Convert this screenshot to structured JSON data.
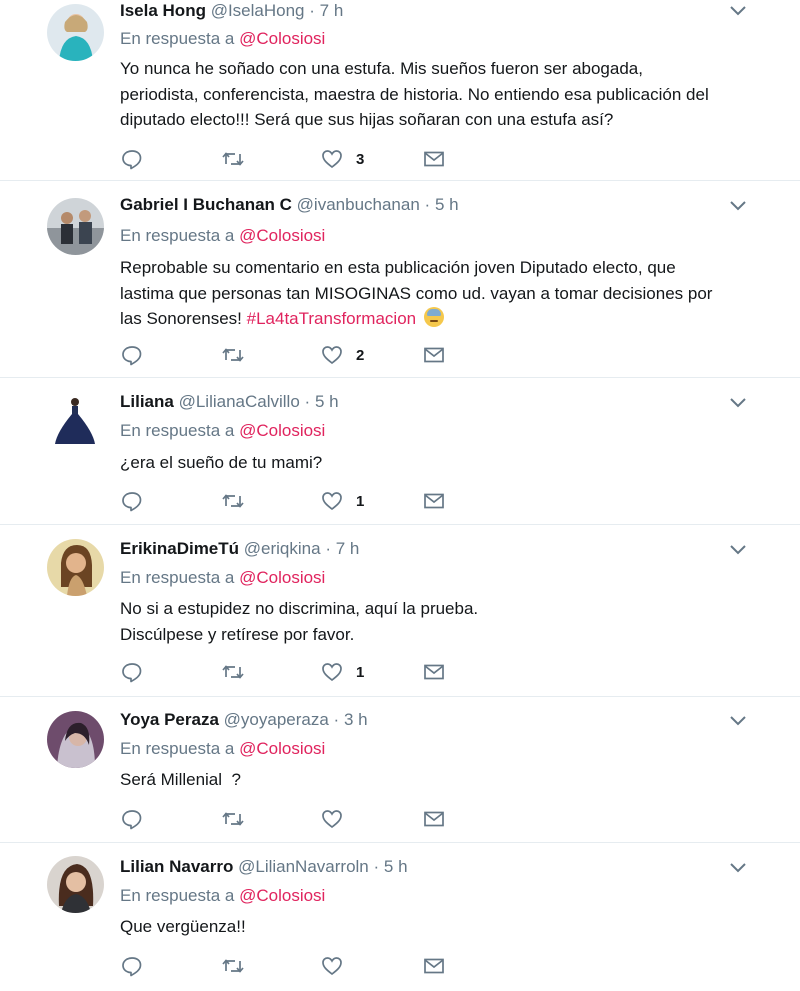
{
  "reply_prefix": "En respuesta a",
  "tweets": [
    {
      "name": "Isela Hong",
      "handle": "@IselaHong",
      "dot": "·",
      "time": "7 h",
      "replying_to": "@Colosiosi",
      "body_lines": [
        "Yo nunca he soñado con una estufa. Mis sueños fueron ser abogada,",
        "periodista, conferencista, maestra de historia. No entiendo esa publicación del",
        "diputado electo!!! Será que sus hijas soñaran con una estufa así?"
      ],
      "likes": "3"
    },
    {
      "name": "Gabriel I Buchanan C",
      "handle": "@ivanbuchanan",
      "dot": "·",
      "time": "5 h",
      "replying_to": "@Colosiosi",
      "body_lines": [
        "Reprobable su comentario en esta publicación joven Diputado electo, que",
        "lastima que personas tan MISOGINAS como ud. vayan a tomar decisiones por",
        "las Sonorenses! "
      ],
      "hashtag": "#La4taTransformacion",
      "emoji": "downcast-sweat-face-emoji",
      "likes": "2"
    },
    {
      "name": "Liliana",
      "handle": "@LilianaCalvillo",
      "dot": "·",
      "time": "5 h",
      "replying_to": "@Colosiosi",
      "body_lines": [
        "¿era el sueño de tu mami?"
      ],
      "likes": "1"
    },
    {
      "name": "ErikinaDimeTú",
      "handle": "@eriqkina",
      "dot": "·",
      "time": "7 h",
      "replying_to": "@Colosiosi",
      "body_lines": [
        "No si a estupidez no discrimina, aquí la prueba.",
        "Discúlpese y retírese por favor."
      ],
      "likes": "1"
    },
    {
      "name": "Yoya Peraza",
      "handle": "@yoyaperaza",
      "dot": "·",
      "time": "3 h",
      "replying_to": "@Colosiosi",
      "body_lines": [
        "Será Millenial  ?"
      ],
      "likes": ""
    },
    {
      "name": "Lilian Navarro",
      "handle": "@LilianNavarroln",
      "dot": "·",
      "time": "5 h",
      "replying_to": "@Colosiosi",
      "body_lines": [
        "Que vergüenza!!"
      ],
      "likes": ""
    }
  ],
  "icons": {
    "reply": "reply-icon",
    "retweet": "retweet-icon",
    "like": "heart-icon",
    "dm": "envelope-icon",
    "more": "chevron-down-icon"
  },
  "colors": {
    "mention": "#e0245e",
    "secondary": "#657786",
    "icon": "#657786",
    "divider": "#e6ecf0"
  }
}
